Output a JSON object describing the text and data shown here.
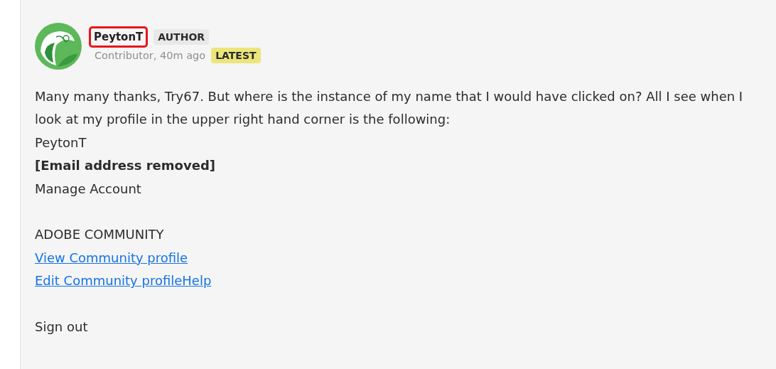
{
  "post": {
    "author": {
      "name": "PeytonT",
      "highlighted": true,
      "role_line": "Contributor, 40m ago"
    },
    "badges": [
      {
        "label": "AUTHOR",
        "kind": "author"
      },
      {
        "label": "LATEST",
        "kind": "latest"
      }
    ],
    "body": [
      {
        "kind": "text",
        "text": "Many many thanks, Try67. But where is the instance of my name that I would have clicked on? All I see when I look at my profile in the upper right hand corner is the following:"
      },
      {
        "kind": "text",
        "text": "PeytonT"
      },
      {
        "kind": "bold",
        "text": "[Email address removed]"
      },
      {
        "kind": "text",
        "text": "Manage Account"
      },
      {
        "kind": "blank"
      },
      {
        "kind": "text",
        "text": "ADOBE COMMUNITY"
      },
      {
        "kind": "link",
        "text": "View Community profile"
      },
      {
        "kind": "link",
        "text": "Edit Community profileHelp"
      },
      {
        "kind": "blank"
      },
      {
        "kind": "text",
        "text": "Sign out"
      }
    ]
  }
}
